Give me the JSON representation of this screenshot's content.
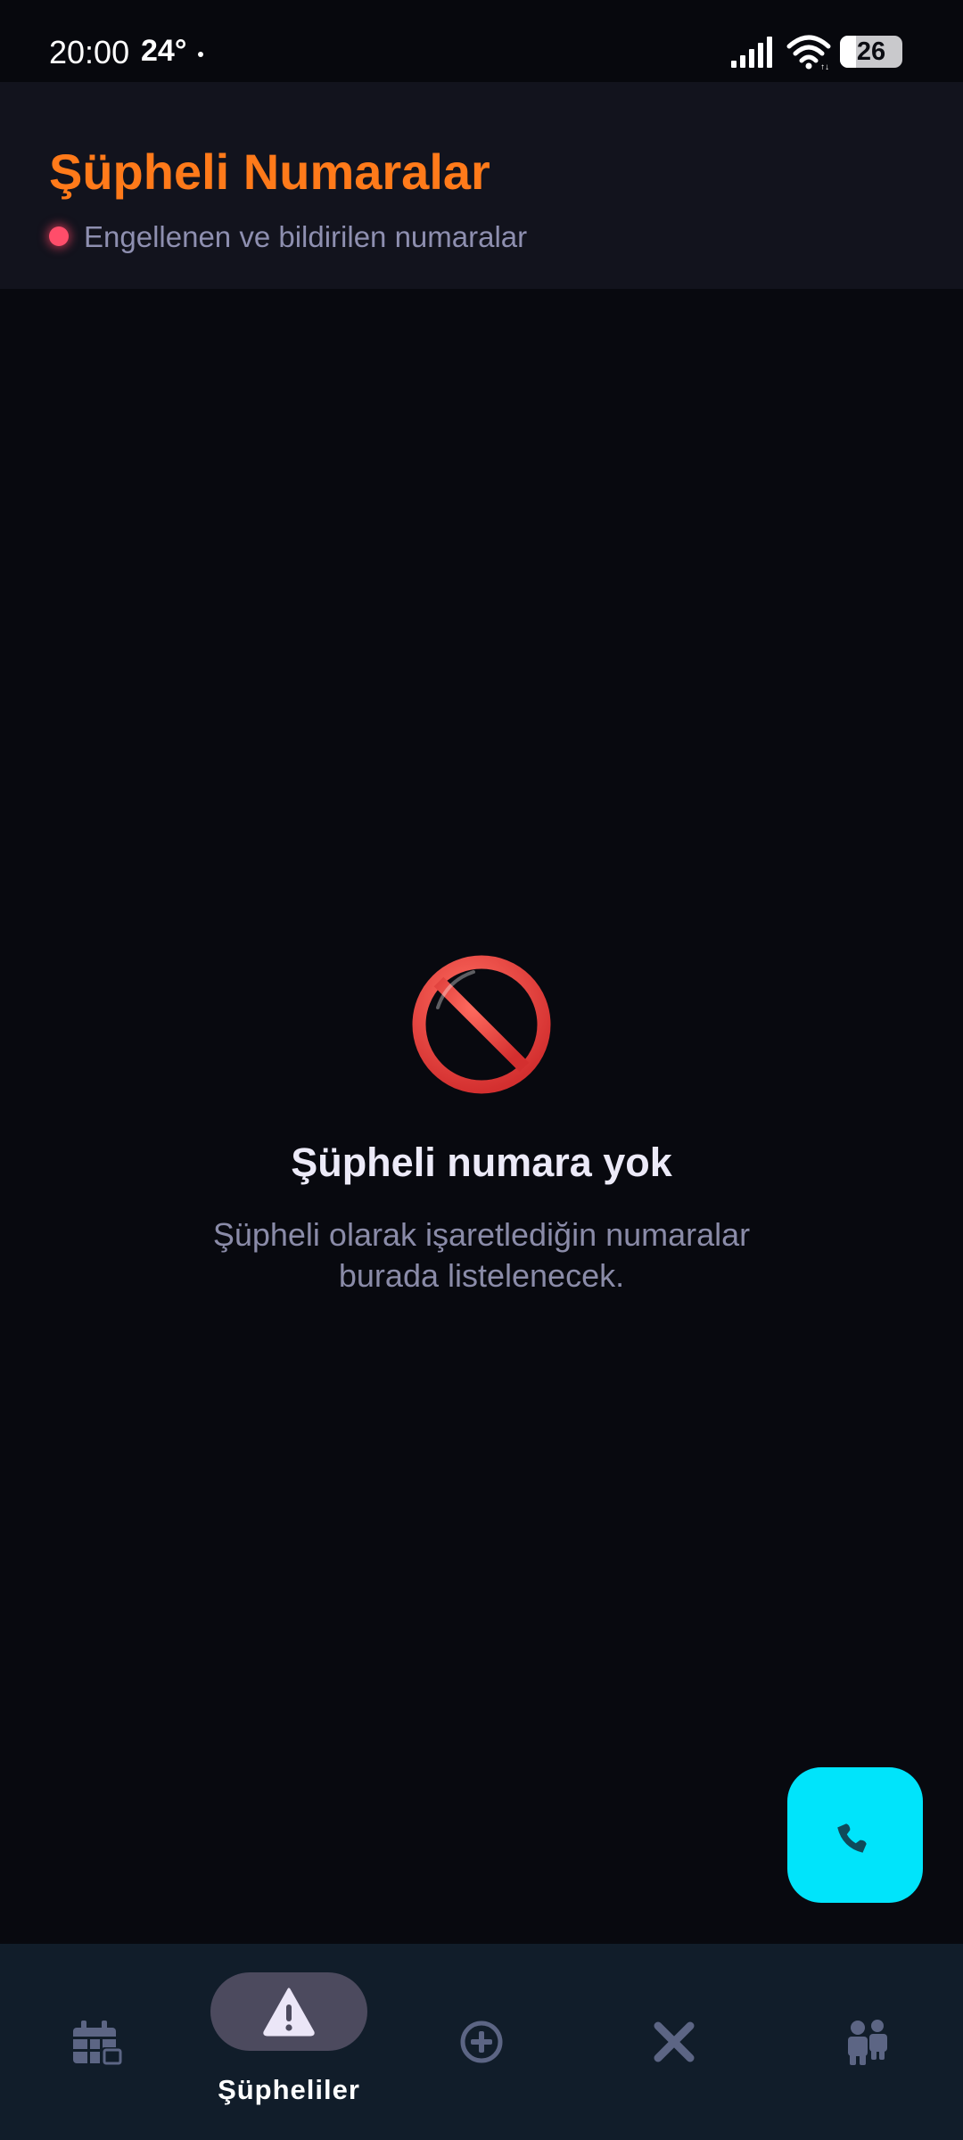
{
  "status_bar": {
    "time": "20:00",
    "temperature": "24°",
    "battery_level": "26",
    "battery_fraction": 0.26
  },
  "header": {
    "title": "Şüpheli Numaralar",
    "subtitle": "Engellenen ve bildirilen numaralar"
  },
  "empty_state": {
    "icon": "prohibited-icon",
    "title": "Şüpheli numara yok",
    "description": "Şüpheli olarak işaretlediğin numaralar burada listelenecek."
  },
  "fab": {
    "icon": "phone-icon"
  },
  "bottom_nav": {
    "items": [
      {
        "icon": "calendar-icon",
        "label": ""
      },
      {
        "icon": "warning-icon",
        "label": "Şüpheliler",
        "active": true
      },
      {
        "icon": "add-circle-icon",
        "label": ""
      },
      {
        "icon": "close-icon",
        "label": ""
      },
      {
        "icon": "people-icon",
        "label": ""
      }
    ]
  },
  "colors": {
    "background": "#08090f",
    "header_bg": "#12131d",
    "title": "#ff7a1a",
    "accent_cyan": "#00e4fb",
    "nav_bg": "#111d2a",
    "nav_icon": "#5c6584",
    "danger": "#e53935"
  }
}
